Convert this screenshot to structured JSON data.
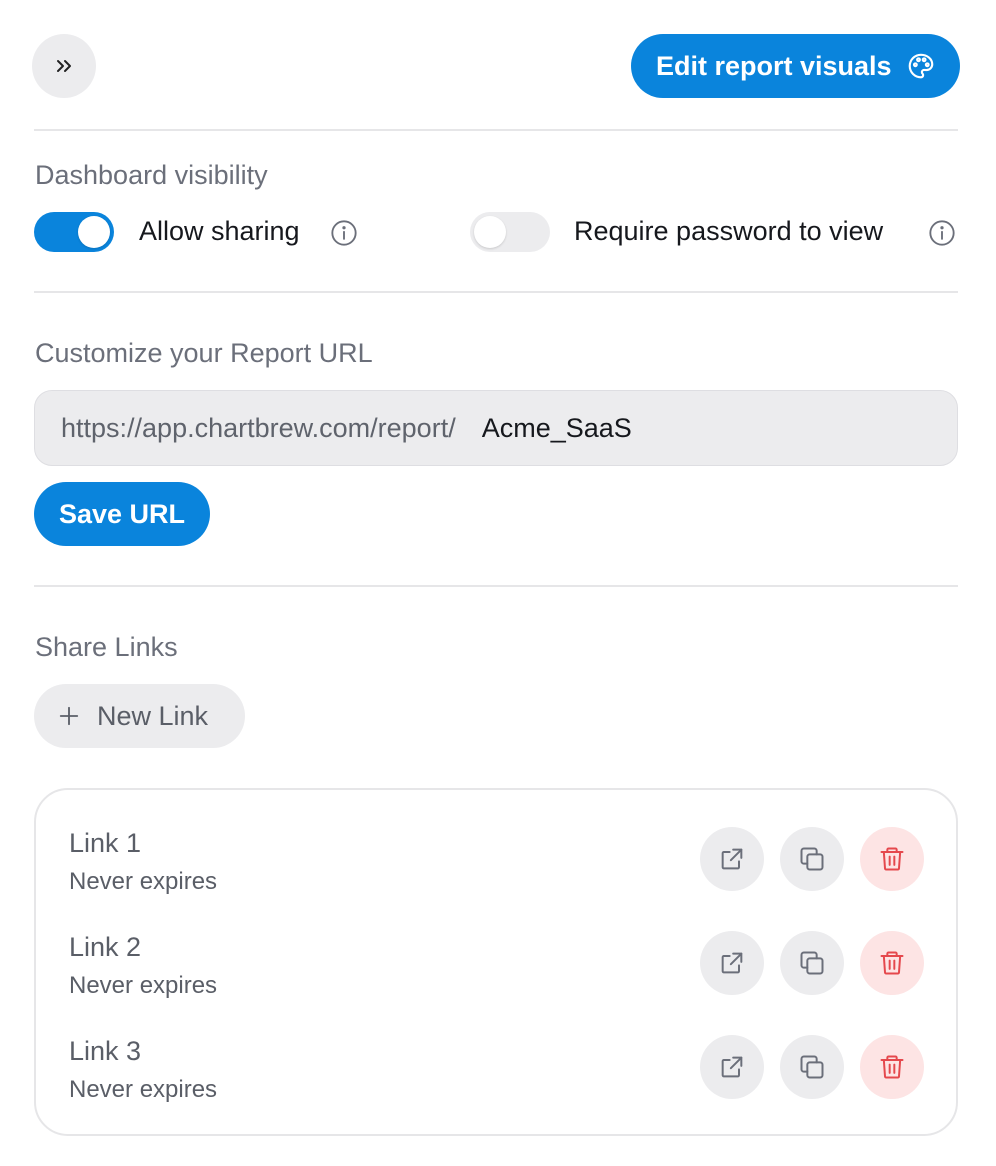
{
  "header": {
    "expand_icon": "chevrons-right-icon",
    "edit_visuals_label": "Edit report visuals",
    "edit_visuals_icon": "palette-icon"
  },
  "visibility": {
    "section_label": "Dashboard visibility",
    "allow_sharing": {
      "label": "Allow sharing",
      "enabled": true
    },
    "require_password": {
      "label": "Require password to view",
      "enabled": false
    }
  },
  "url": {
    "section_label": "Customize your Report URL",
    "prefix": "https://app.chartbrew.com/report/",
    "value": "Acme_SaaS",
    "save_label": "Save URL"
  },
  "share_links": {
    "section_label": "Share Links",
    "new_link_label": "New Link",
    "links": [
      {
        "name": "Link 1",
        "expiry": "Never expires"
      },
      {
        "name": "Link 2",
        "expiry": "Never expires"
      },
      {
        "name": "Link 3",
        "expiry": "Never expires"
      }
    ]
  },
  "colors": {
    "primary": "#0a84dc",
    "danger": "#e5484d",
    "muted_bg": "#ececee"
  }
}
